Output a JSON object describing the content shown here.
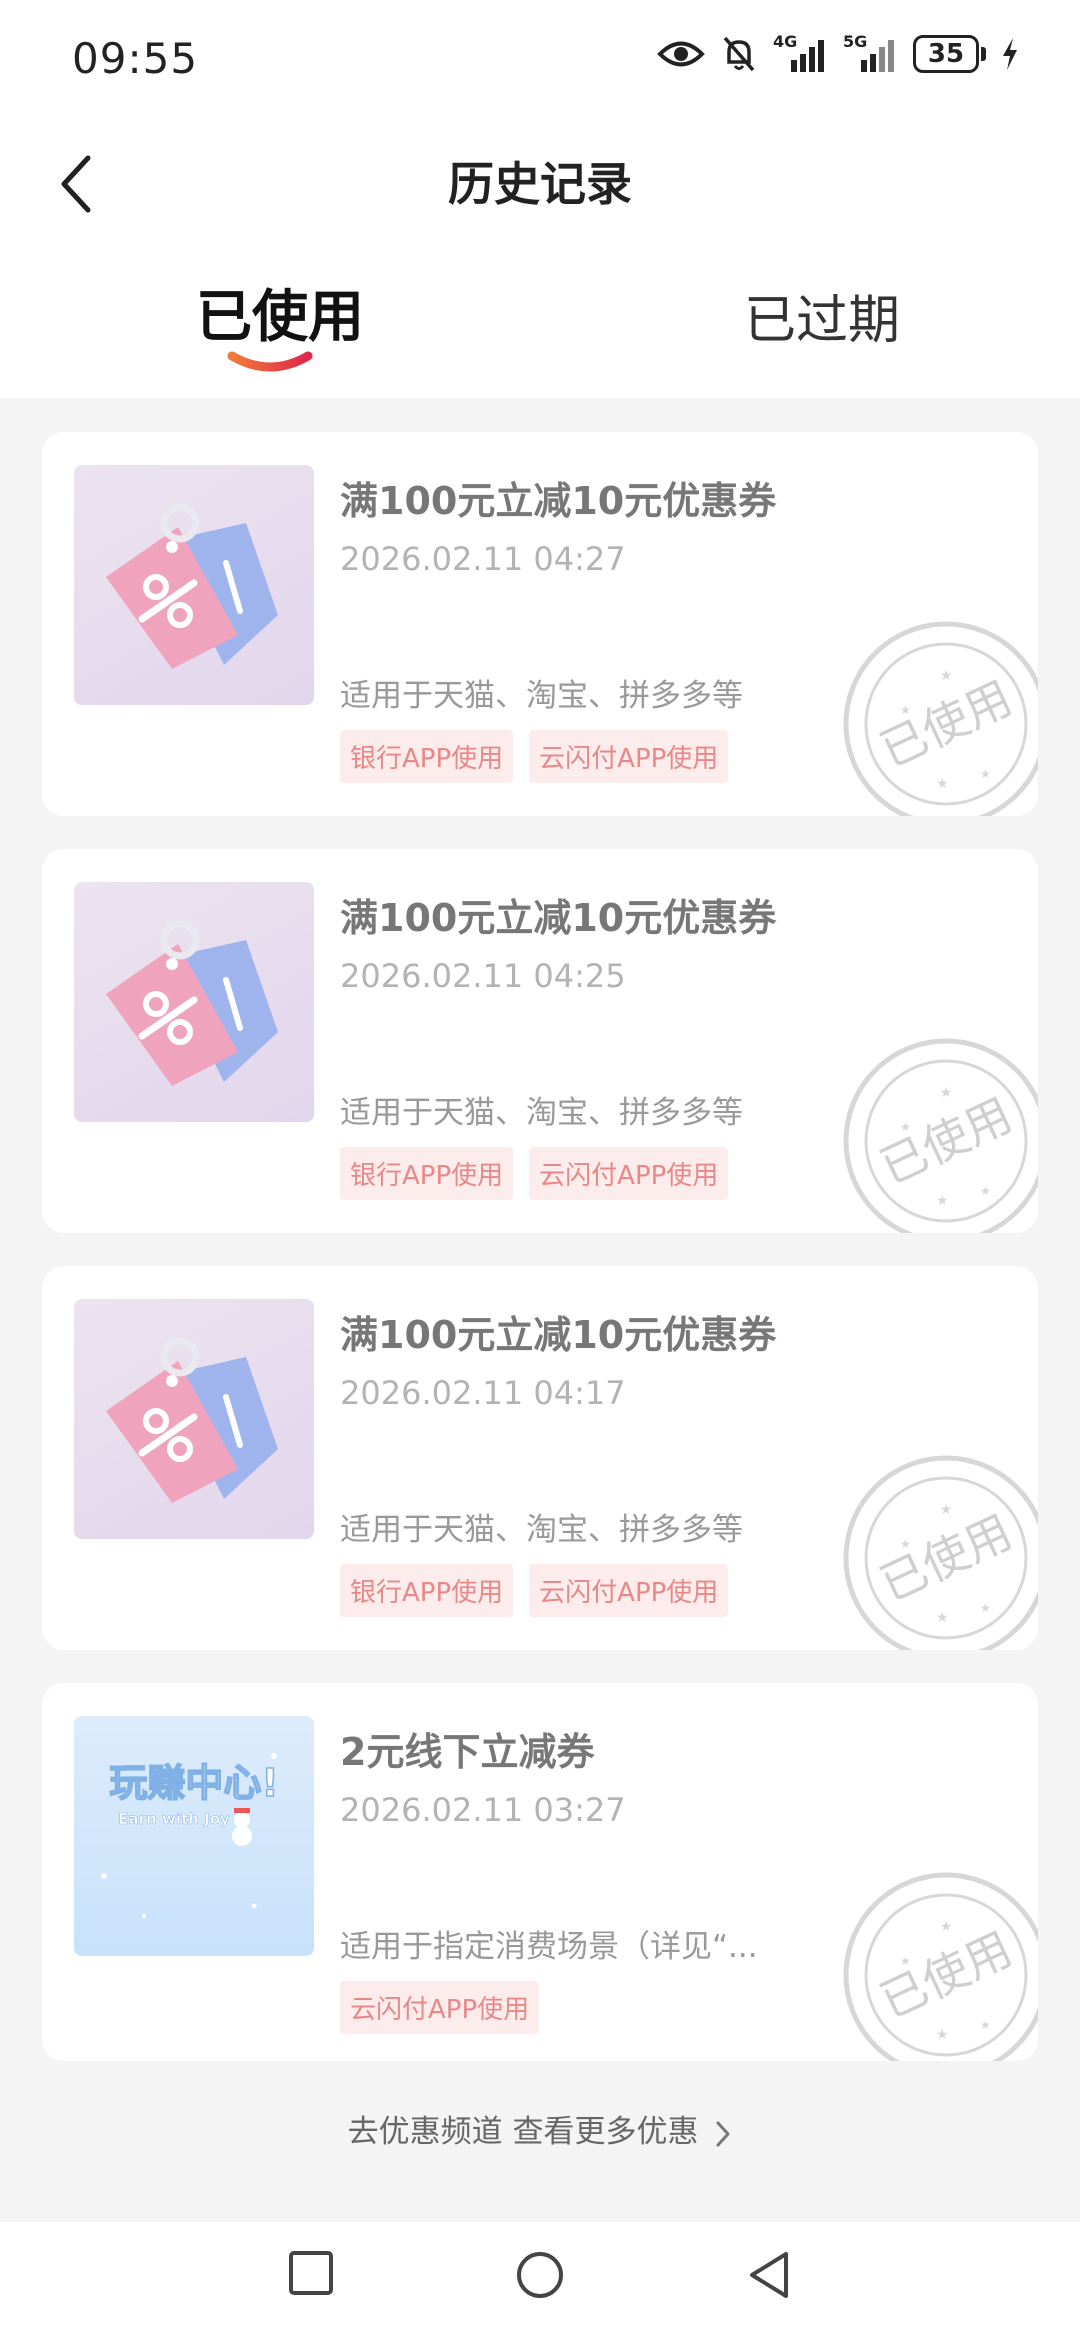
{
  "status": {
    "time": "09:55",
    "network1": "4G",
    "network2": "5G",
    "battery": "35"
  },
  "header": {
    "title": "历史记录"
  },
  "tabs": [
    {
      "label": "已使用",
      "active": true
    },
    {
      "label": "已过期",
      "active": false
    }
  ],
  "coupons": [
    {
      "title": "满100元立减10元优惠券",
      "date": "2026.02.11 04:27",
      "scope": "适用于天猫、淘宝、拼多多等",
      "tags": [
        "银行APP使用",
        "云闪付APP使用"
      ],
      "image": "discount-tags-icon",
      "stamp": "已使用"
    },
    {
      "title": "满100元立减10元优惠券",
      "date": "2026.02.11 04:25",
      "scope": "适用于天猫、淘宝、拼多多等",
      "tags": [
        "银行APP使用",
        "云闪付APP使用"
      ],
      "image": "discount-tags-icon",
      "stamp": "已使用"
    },
    {
      "title": "满100元立减10元优惠券",
      "date": "2026.02.11 04:17",
      "scope": "适用于天猫、淘宝、拼多多等",
      "tags": [
        "银行APP使用",
        "云闪付APP使用"
      ],
      "image": "discount-tags-icon",
      "stamp": "已使用"
    },
    {
      "title": "2元线下立减券",
      "date": "2026.02.11 03:27",
      "scope": "适用于指定消费场景（详见“...",
      "tags": [
        "云闪付APP使用"
      ],
      "image": "earn-center-banner",
      "banner_cn": "玩赚中心!",
      "banner_en": "Earn with Joy",
      "stamp": "已使用"
    }
  ],
  "footer": {
    "more_link": "去优惠频道 查看更多优惠"
  },
  "colors": {
    "accent": "#e8463c",
    "tag_bg": "#fdecec",
    "tag_text": "#e88888",
    "background": "#f4f4f4"
  }
}
